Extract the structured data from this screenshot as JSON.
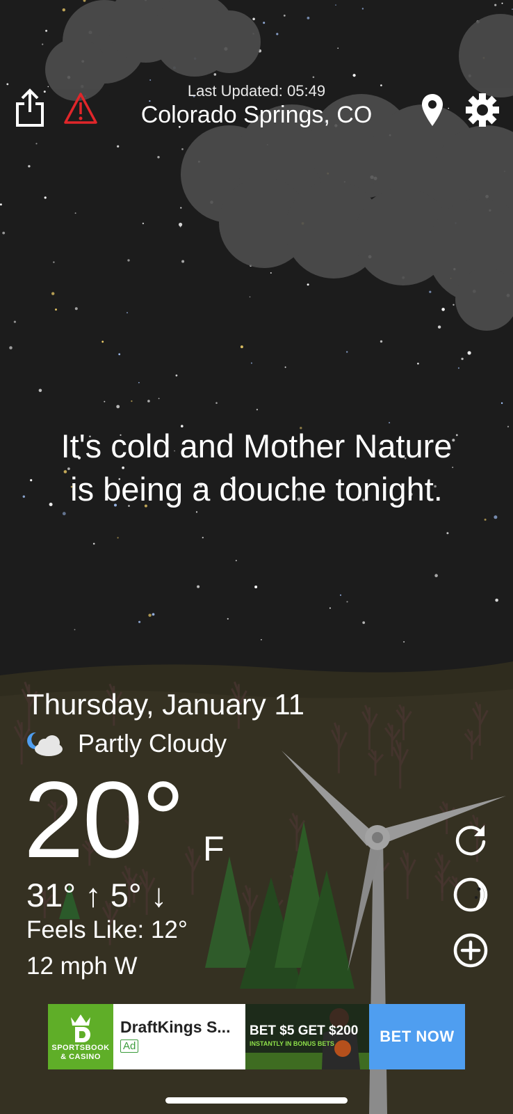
{
  "header": {
    "last_updated": "Last Updated: 05:49",
    "location": "Colorado Springs, CO"
  },
  "message": {
    "line1": "It's cold and Mother Nature",
    "line2": "is being a douche tonight."
  },
  "forecast": {
    "date": "Thursday, January 11",
    "condition": "Partly Cloudy",
    "condition_icon": "partly-cloudy-night-icon",
    "temperature": "20°",
    "unit": "F",
    "high_low": "31° ↑ 5° ↓",
    "feels_like": "Feels Like: 12°",
    "wind": "12 mph W"
  },
  "actions": {
    "left": [
      "share-icon",
      "alert-icon"
    ],
    "right": [
      "location-pin-icon",
      "gear-icon"
    ],
    "side": [
      "refresh-icon",
      "moon-icon",
      "add-icon"
    ]
  },
  "ad": {
    "logo_text_1": "SPORTSBOOK",
    "logo_text_2": "& CASINO",
    "title": "DraftKings S...",
    "tag": "Ad",
    "headline": "BET $5 GET $200",
    "subline": "INSTANTLY IN BONUS BETS",
    "cta": "BET NOW",
    "brand_color": "#5fae28",
    "cta_color": "#4f9ef0"
  },
  "colors": {
    "sky": "#1c1c1c",
    "ground": "#2f2c1e",
    "alert": "#e0262a"
  }
}
